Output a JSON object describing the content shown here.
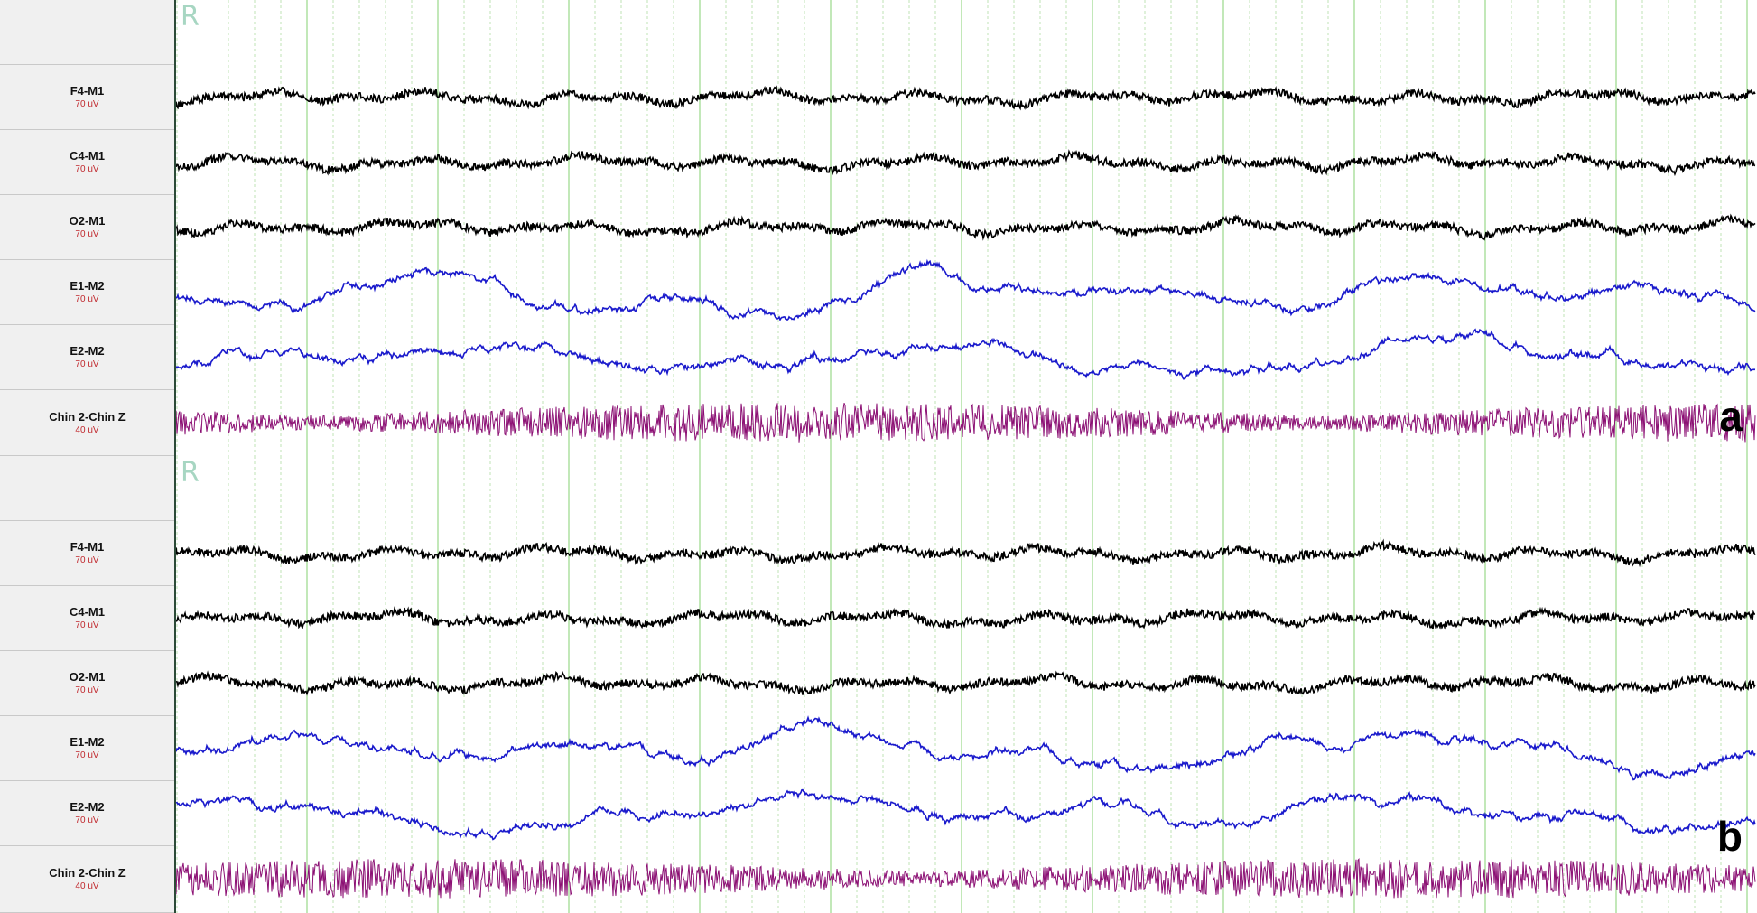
{
  "panels": [
    {
      "id": "a",
      "marker": "R",
      "tag": "a",
      "channels": [
        {
          "name": "F4-M1",
          "scale": "70 uV",
          "color": "#000000",
          "kind": "eeg"
        },
        {
          "name": "C4-M1",
          "scale": "70 uV",
          "color": "#000000",
          "kind": "eeg"
        },
        {
          "name": "O2-M1",
          "scale": "70 uV",
          "color": "#000000",
          "kind": "eeg"
        },
        {
          "name": "E1-M2",
          "scale": "70 uV",
          "color": "#1a1acc",
          "kind": "eog"
        },
        {
          "name": "E2-M2",
          "scale": "70 uV",
          "color": "#1a1acc",
          "kind": "eog"
        },
        {
          "name": "Chin 2-Chin Z",
          "scale": "40 uV",
          "color": "#8b0f73",
          "kind": "emg"
        }
      ]
    },
    {
      "id": "b",
      "marker": "R",
      "tag": "b",
      "channels": [
        {
          "name": "F4-M1",
          "scale": "70 uV",
          "color": "#000000",
          "kind": "eeg"
        },
        {
          "name": "C4-M1",
          "scale": "70 uV",
          "color": "#000000",
          "kind": "eeg"
        },
        {
          "name": "O2-M1",
          "scale": "70 uV",
          "color": "#000000",
          "kind": "eeg"
        },
        {
          "name": "E1-M2",
          "scale": "70 uV",
          "color": "#1a1acc",
          "kind": "eog"
        },
        {
          "name": "E2-M2",
          "scale": "70 uV",
          "color": "#1a1acc",
          "kind": "eog"
        },
        {
          "name": "Chin 2-Chin Z",
          "scale": "40 uV",
          "color": "#8b0f73",
          "kind": "emg"
        }
      ]
    }
  ],
  "grid": {
    "major_color": "#9ad88a",
    "minor_color": "#bfe3b5"
  }
}
